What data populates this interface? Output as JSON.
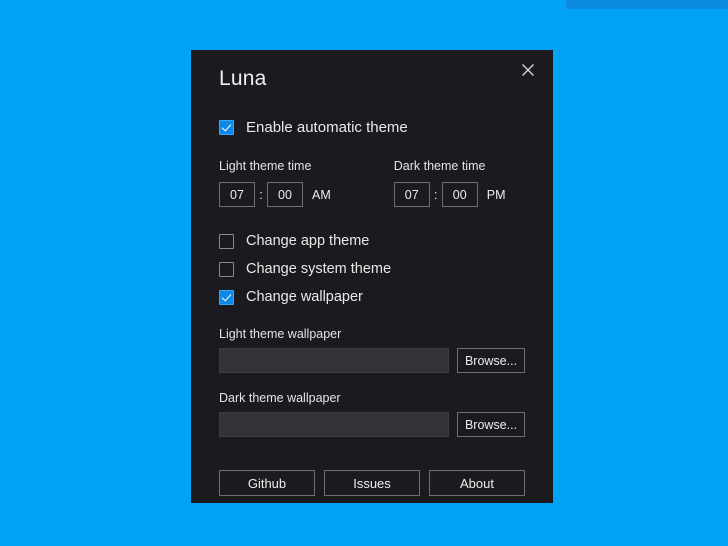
{
  "desktop": {
    "background_color": "#02a2f7",
    "top_strip_color": "#0b8ae0"
  },
  "dialog": {
    "title": "Luna",
    "close_icon": "close-icon",
    "background_color": "#1b1b1f",
    "accent_color": "#0b88e8"
  },
  "automatic_theme": {
    "label": "Enable automatic theme",
    "checked": true
  },
  "light_theme_time": {
    "label": "Light theme time",
    "hour": "07",
    "separator": ":",
    "minute": "00",
    "meridiem": "AM"
  },
  "dark_theme_time": {
    "label": "Dark theme time",
    "hour": "07",
    "separator": ":",
    "minute": "00",
    "meridiem": "PM"
  },
  "options": [
    {
      "label": "Change app theme",
      "checked": false
    },
    {
      "label": "Change system theme",
      "checked": false
    },
    {
      "label": "Change wallpaper",
      "checked": true
    }
  ],
  "light_wallpaper": {
    "label": "Light theme wallpaper",
    "value": "",
    "placeholder": "",
    "browse_label": "Browse..."
  },
  "dark_wallpaper": {
    "label": "Dark theme wallpaper",
    "value": "",
    "placeholder": "",
    "browse_label": "Browse..."
  },
  "footer": {
    "github_label": "Github",
    "issues_label": "Issues",
    "about_label": "About"
  }
}
